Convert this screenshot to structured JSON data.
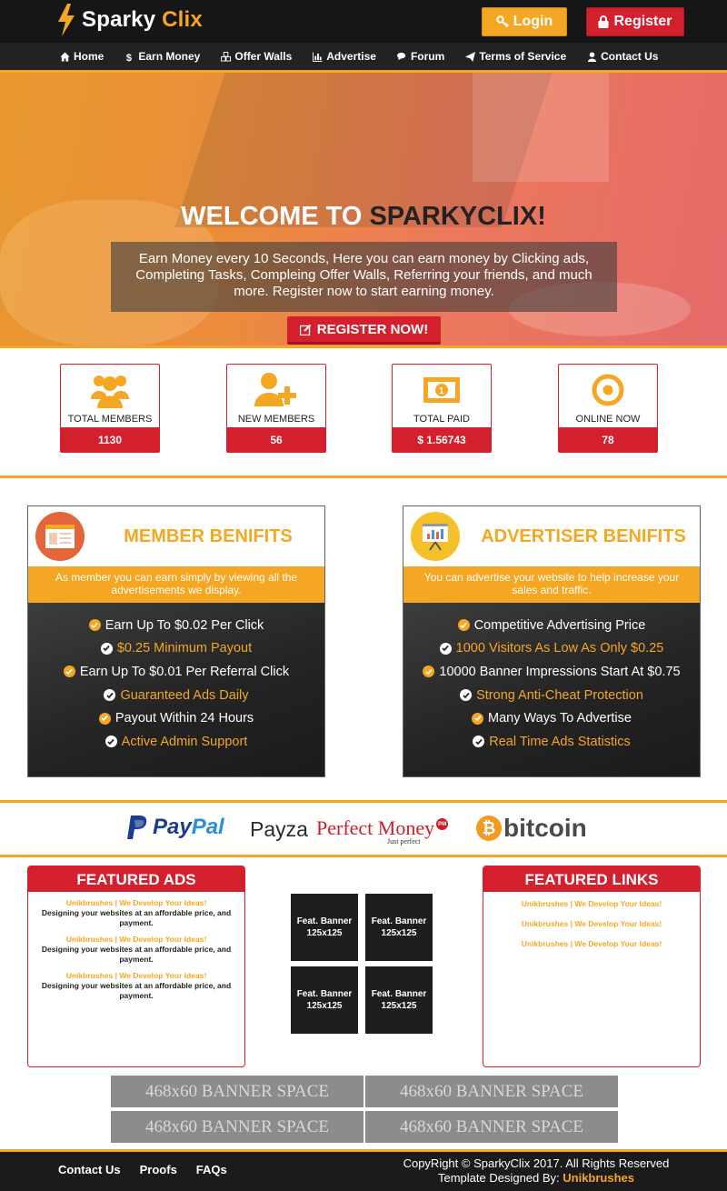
{
  "brand": {
    "name_part1": "Sparky",
    "name_part2": "Clix",
    "accent": "#f5a623",
    "red": "#d4202d"
  },
  "header": {
    "login_label": "Login",
    "register_label": "Register"
  },
  "nav": [
    {
      "label": "Home",
      "icon": "home-icon"
    },
    {
      "label": "Earn Money",
      "icon": "dollar-icon"
    },
    {
      "label": "Offer Walls",
      "icon": "cubes-icon"
    },
    {
      "label": "Advertise",
      "icon": "bar-chart-icon"
    },
    {
      "label": "Forum",
      "icon": "comments-icon"
    },
    {
      "label": "Terms of Service",
      "icon": "paper-plane-icon"
    },
    {
      "label": "Contact Us",
      "icon": "user-icon"
    }
  ],
  "hero": {
    "title_part1": "WELCOME TO ",
    "title_part2": "SPARKYCLIX!",
    "text": "Earn Money every 10 Seconds, Here you can earn money by Clicking ads, Completing Tasks, Compleing Offer Walls, Referring your friends, and much more. Register now to start earning money.",
    "cta_label": "REGISTER NOW!"
  },
  "stats": [
    {
      "label": "TOTAL MEMBERS",
      "value": "1130",
      "icon": "users-icon"
    },
    {
      "label": "NEW MEMBERS",
      "value": "56",
      "icon": "user-plus-icon"
    },
    {
      "label": "TOTAL PAID",
      "value": "$ 1.56743",
      "icon": "money-icon"
    },
    {
      "label": "ONLINE NOW",
      "value": "78",
      "icon": "bullseye-icon"
    }
  ],
  "member": {
    "title": "MEMBER BENIFITS",
    "subtitle": "As member you can earn simply by viewing all the advertisements we display.",
    "items": [
      "Earn Up To $0.02 Per Click",
      "$0.25 Minimum Payout",
      "Earn Up To $0.01 Per Referral Click",
      "Guaranteed Ads Daily",
      "Payout Within 24 Hours",
      "Active Admin Support"
    ]
  },
  "advertiser": {
    "title": "ADVERTISER BENIFITS",
    "subtitle": "You can advertise your website to help increase your sales and traffic.",
    "items": [
      "Competitive Advertising Price",
      "1000 Visitors As Low As Only $0.25",
      "10000 Banner Impressions Start At $0.75",
      "Strong Anti-Cheat Protection",
      "Many Ways To Advertise",
      "Real Time Ads Statistics"
    ]
  },
  "payments": {
    "paypal_a": "Pay",
    "paypal_b": "Pal",
    "payza": "Payza",
    "pm_a": "Perfect",
    "pm_b": "Money",
    "pm_badge": "PM",
    "pm_tag": "Just perfect",
    "btc_symbol": "₿",
    "bitcoin": "bitcoin"
  },
  "featured_ads": {
    "title": "FEATURED ADS",
    "ads": [
      {
        "title": "Unikbrushes | We Develop Your Ideas!",
        "desc": "Designing your websites at an affordable price, and payment."
      },
      {
        "title": "Unikbrushes | We Develop Your Ideas!",
        "desc": "Designing your websites at an affordable price, and payment."
      },
      {
        "title": "Unikbrushes | We Develop Your Ideas!",
        "desc": "Designing your websites at an affordable price, and payment."
      }
    ]
  },
  "feat_banners": [
    "Feat. Banner 125x125",
    "Feat. Banner 125x125",
    "Feat. Banner 125x125",
    "Feat. Banner 125x125"
  ],
  "featured_links": {
    "title": "FEATURED LINKS",
    "links": [
      "Unikbrushes | We Develop Your Ideas!",
      "Unikbrushes | We Develop Your Ideas!",
      "Unikbrushes | We Develop Your Ideas!"
    ]
  },
  "banner_spaces": [
    "468x60 BANNER SPACE",
    "468x60 BANNER SPACE",
    "468x60 BANNER SPACE",
    "468x60 BANNER SPACE"
  ],
  "footer": {
    "links": [
      "Contact Us",
      "Proofs",
      "FAQs"
    ],
    "copyright": "CopyRight © SparkyClix 2017. All Rights Reserved",
    "designed_prefix": "Template Designed By: ",
    "designer": "Unikbrushes"
  }
}
